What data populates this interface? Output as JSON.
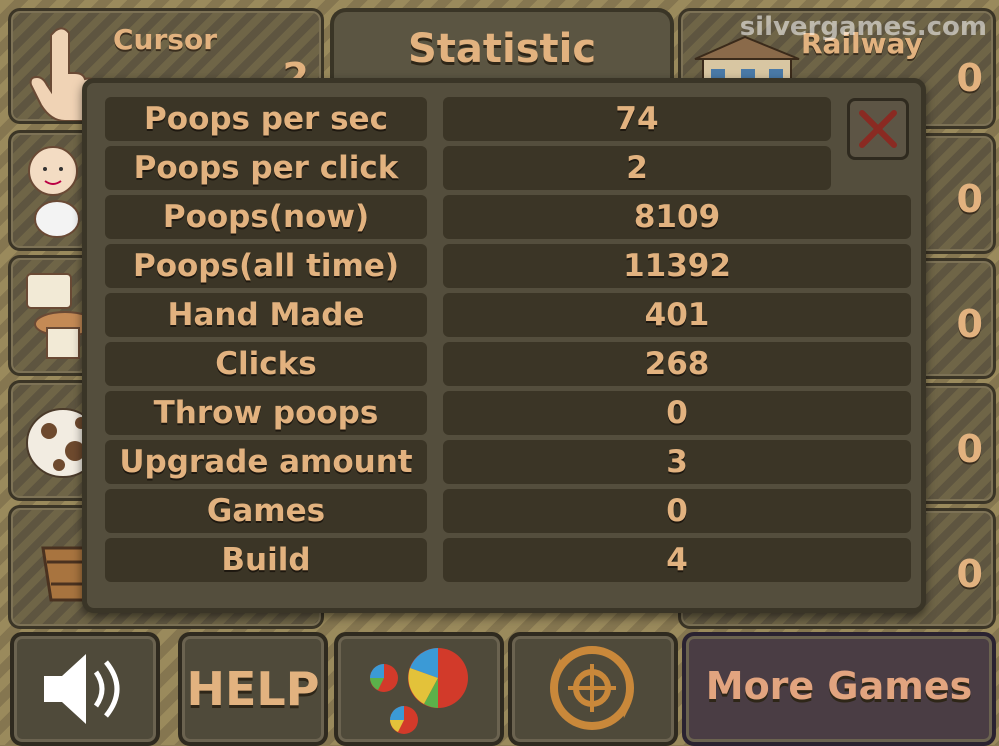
{
  "header": {
    "tab_title": "Statistic",
    "watermark": "silvergames.com"
  },
  "background_tiles": {
    "cursor": {
      "name": "Cursor",
      "count": "2"
    },
    "railway": {
      "name": "Railway",
      "count": "0"
    },
    "right_counts": [
      "0",
      "0",
      "0",
      "0"
    ]
  },
  "stats": [
    {
      "label": "Poops per sec",
      "value": "74"
    },
    {
      "label": "Poops per click",
      "value": "2"
    },
    {
      "label": "Poops(now)",
      "value": "8109"
    },
    {
      "label": "Poops(all time)",
      "value": "11392"
    },
    {
      "label": "Hand Made",
      "value": "401"
    },
    {
      "label": "Clicks",
      "value": "268"
    },
    {
      "label": "Throw poops",
      "value": "0"
    },
    {
      "label": "Upgrade amount",
      "value": "3"
    },
    {
      "label": "Games",
      "value": "0"
    },
    {
      "label": "Build",
      "value": "4"
    }
  ],
  "bottom_bar": {
    "help_label": "HELP",
    "more_games_label": "More Games"
  },
  "colors": {
    "text_gold": "#e2b27f",
    "panel_bg": "#544e3d",
    "cell_bg": "#3b3526",
    "close_x": "#8a2a22"
  }
}
